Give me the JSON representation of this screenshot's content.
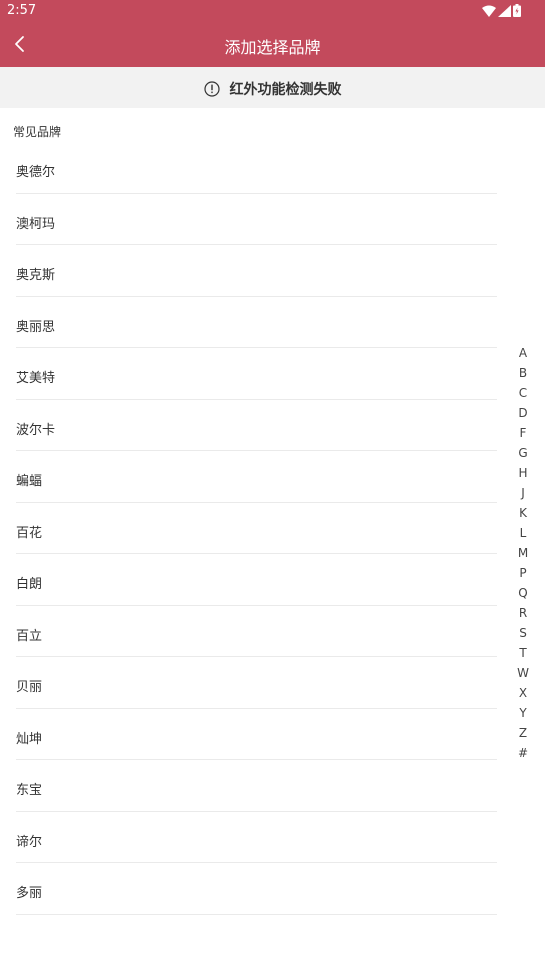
{
  "status_bar": {
    "time": "2:57"
  },
  "app_bar": {
    "title": "添加选择品牌"
  },
  "warning": {
    "text": "红外功能检测失败"
  },
  "section": {
    "title": "常见品牌"
  },
  "brands": [
    "奥德尔",
    "澳柯玛",
    "奥克斯",
    "奥丽思",
    "艾美特",
    "波尔卡",
    "蝙蝠",
    "百花",
    "白朗",
    "百立",
    "贝丽",
    "灿坤",
    "东宝",
    "谛尔",
    "多丽"
  ],
  "index_letters": [
    "A",
    "B",
    "C",
    "D",
    "F",
    "G",
    "H",
    "J",
    "K",
    "L",
    "M",
    "P",
    "Q",
    "R",
    "S",
    "T",
    "W",
    "X",
    "Y",
    "Z",
    "#"
  ],
  "colors": {
    "accent": "#c34a5c",
    "banner_bg": "#f2f2f2",
    "divider": "#eaeaea"
  },
  "icons": [
    "wifi-icon",
    "signal-icon",
    "battery-icon",
    "back-arrow-icon",
    "warning-circle-icon"
  ]
}
